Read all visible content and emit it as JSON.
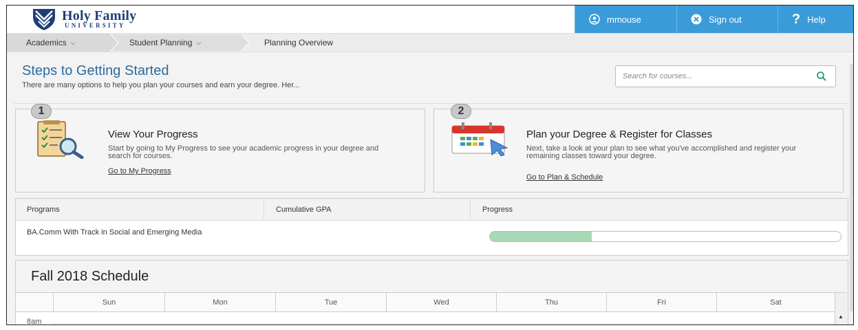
{
  "header": {
    "logo_name": "Holy Family",
    "logo_sub": "UNIVERSITY",
    "nav": [
      {
        "label": "mmouse",
        "icon": "user-icon"
      },
      {
        "label": "Sign out",
        "icon": "sign-out-icon"
      },
      {
        "label": "Help",
        "icon": "help-icon"
      }
    ]
  },
  "breadcrumb": [
    "Academics",
    "Student Planning",
    "Planning Overview"
  ],
  "main": {
    "title": "Steps to Getting Started",
    "subtitle": "There are many options to help you plan your courses and earn your degree. Her...",
    "search_placeholder": "Search for courses..."
  },
  "steps": [
    {
      "number": "1",
      "title": "View Your Progress",
      "text": "Start by going to My Progress to see your academic progress in your degree and search for courses.",
      "link": "Go to My Progress",
      "icon": "checklist-magnifier-icon"
    },
    {
      "number": "2",
      "title": "Plan your Degree & Register for Classes",
      "text": "Next, take a look at your plan to see what you've accomplished and register your remaining classes toward your degree.",
      "link": "Go to Plan & Schedule",
      "icon": "calendar-cursor-icon"
    }
  ],
  "programs": {
    "headers": [
      "Programs",
      "Cumulative GPA",
      "Progress"
    ],
    "rows": [
      {
        "program": "BA.Comm With Track in Social and Emerging Media",
        "gpa": "",
        "progress_fraction": 0.29
      }
    ]
  },
  "schedule": {
    "title": "Fall 2018 Schedule",
    "days": [
      "Sun",
      "Mon",
      "Tue",
      "Wed",
      "Thu",
      "Fri",
      "Sat"
    ],
    "first_time": "8am"
  },
  "colors": {
    "brand_blue": "#3a9bd9",
    "title_blue": "#2c6aa0",
    "progress_green": "#a7d8b5"
  }
}
